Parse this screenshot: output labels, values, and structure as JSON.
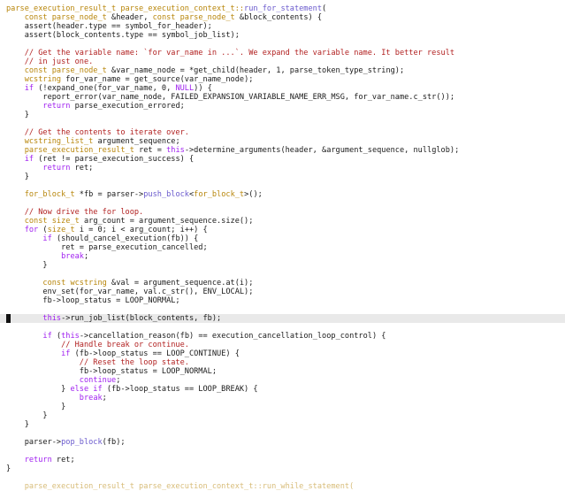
{
  "editor": {
    "cursor_line_index": 35,
    "colors": {
      "keyword": "#a020f0",
      "type": "#b8860b",
      "function": "#6a5acd",
      "string": "#8b4513",
      "comment": "#b22222",
      "number": "#1a1a1a",
      "operator": "#1a1a1a",
      "default": "#1a1a1a",
      "current_line": "#e9e9e9"
    },
    "lines": [
      [
        [
          "parse_execution_result_t parse_execution_context_t::",
          "type"
        ],
        [
          "run_for_statement",
          "function"
        ],
        [
          "(",
          "default"
        ]
      ],
      [
        [
          "    ",
          "default"
        ],
        [
          "const parse_node_t",
          "type"
        ],
        [
          " &header, ",
          "default"
        ],
        [
          "const parse_node_t",
          "type"
        ],
        [
          " &block_contents) {",
          "default"
        ]
      ],
      [
        [
          "    assert(header.type == symbol_for_header);",
          "default"
        ]
      ],
      [
        [
          "    assert(block_contents.type == symbol_job_list);",
          "default"
        ]
      ],
      [
        [
          "",
          "default"
        ]
      ],
      [
        [
          "    // Get the variable name: `for var_name in ...`. We expand the variable name. It better result",
          "comment"
        ]
      ],
      [
        [
          "    // in just one.",
          "comment"
        ]
      ],
      [
        [
          "    ",
          "default"
        ],
        [
          "const parse_node_t",
          "type"
        ],
        [
          " &var_name_node = *get_child(header, 1, parse_token_type_string);",
          "default"
        ]
      ],
      [
        [
          "    ",
          "default"
        ],
        [
          "wcstring",
          "type"
        ],
        [
          " for_var_name = get_source(var_name_node);",
          "default"
        ]
      ],
      [
        [
          "    ",
          "default"
        ],
        [
          "if",
          "keyword"
        ],
        [
          " (!expand_one(for_var_name, 0, ",
          "default"
        ],
        [
          "NULL",
          "keyword"
        ],
        [
          ")) {",
          "default"
        ]
      ],
      [
        [
          "        report_error(var_name_node, FAILED_EXPANSION_VARIABLE_NAME_ERR_MSG, for_var_name.c_str());",
          "default"
        ]
      ],
      [
        [
          "        ",
          "default"
        ],
        [
          "return",
          "keyword"
        ],
        [
          " parse_execution_errored;",
          "default"
        ]
      ],
      [
        [
          "    }",
          "default"
        ]
      ],
      [
        [
          "",
          "default"
        ]
      ],
      [
        [
          "    // Get the contents to iterate over.",
          "comment"
        ]
      ],
      [
        [
          "    ",
          "default"
        ],
        [
          "wcstring_list_t",
          "type"
        ],
        [
          " argument_sequence;",
          "default"
        ]
      ],
      [
        [
          "    ",
          "default"
        ],
        [
          "parse_execution_result_t",
          "type"
        ],
        [
          " ret = ",
          "default"
        ],
        [
          "this",
          "keyword"
        ],
        [
          "->determine_arguments(header, &argument_sequence, nullglob);",
          "default"
        ]
      ],
      [
        [
          "    ",
          "default"
        ],
        [
          "if",
          "keyword"
        ],
        [
          " (ret != parse_execution_success) {",
          "default"
        ]
      ],
      [
        [
          "        ",
          "default"
        ],
        [
          "return",
          "keyword"
        ],
        [
          " ret;",
          "default"
        ]
      ],
      [
        [
          "    }",
          "default"
        ]
      ],
      [
        [
          "",
          "default"
        ]
      ],
      [
        [
          "    ",
          "default"
        ],
        [
          "for_block_t",
          "type"
        ],
        [
          " *fb = parser->",
          "default"
        ],
        [
          "push_block",
          "function"
        ],
        [
          "<",
          "default"
        ],
        [
          "for_block_t",
          "type"
        ],
        [
          ">();",
          "default"
        ]
      ],
      [
        [
          "",
          "default"
        ]
      ],
      [
        [
          "    // Now drive the for loop.",
          "comment"
        ]
      ],
      [
        [
          "    ",
          "default"
        ],
        [
          "const size_t",
          "type"
        ],
        [
          " arg_count = argument_sequence.size();",
          "default"
        ]
      ],
      [
        [
          "    ",
          "default"
        ],
        [
          "for",
          "keyword"
        ],
        [
          " (",
          "default"
        ],
        [
          "size_t",
          "type"
        ],
        [
          " i = 0; i < arg_count; i++) {",
          "default"
        ]
      ],
      [
        [
          "        ",
          "default"
        ],
        [
          "if",
          "keyword"
        ],
        [
          " (should_cancel_execution(fb)) {",
          "default"
        ]
      ],
      [
        [
          "            ret = parse_execution_cancelled;",
          "default"
        ]
      ],
      [
        [
          "            ",
          "default"
        ],
        [
          "break",
          "keyword"
        ],
        [
          ";",
          "default"
        ]
      ],
      [
        [
          "        }",
          "default"
        ]
      ],
      [
        [
          "",
          "default"
        ]
      ],
      [
        [
          "        ",
          "default"
        ],
        [
          "const wcstring",
          "type"
        ],
        [
          " &val = argument_sequence.at(i);",
          "default"
        ]
      ],
      [
        [
          "        env_set(for_var_name, val.c_str(), ENV_LOCAL);",
          "default"
        ]
      ],
      [
        [
          "        fb->loop_status = LOOP_NORMAL;",
          "default"
        ]
      ],
      [
        [
          "",
          "default"
        ]
      ],
      [
        [
          "        ",
          "default"
        ],
        [
          "this",
          "keyword"
        ],
        [
          "->run_job_list(block_contents, fb);",
          "default"
        ]
      ],
      [
        [
          "",
          "default"
        ]
      ],
      [
        [
          "        ",
          "default"
        ],
        [
          "if",
          "keyword"
        ],
        [
          " (",
          "default"
        ],
        [
          "this",
          "keyword"
        ],
        [
          "->cancellation_reason(fb) == execution_cancellation_loop_control) {",
          "default"
        ]
      ],
      [
        [
          "            // Handle break or continue.",
          "comment"
        ]
      ],
      [
        [
          "            ",
          "default"
        ],
        [
          "if",
          "keyword"
        ],
        [
          " (fb->loop_status == LOOP_CONTINUE) {",
          "default"
        ]
      ],
      [
        [
          "                // Reset the loop state.",
          "comment"
        ]
      ],
      [
        [
          "                fb->loop_status = LOOP_NORMAL;",
          "default"
        ]
      ],
      [
        [
          "                ",
          "default"
        ],
        [
          "continue",
          "keyword"
        ],
        [
          ";",
          "default"
        ]
      ],
      [
        [
          "            } ",
          "default"
        ],
        [
          "else if",
          "keyword"
        ],
        [
          " (fb->loop_status == LOOP_BREAK) {",
          "default"
        ]
      ],
      [
        [
          "                ",
          "default"
        ],
        [
          "break",
          "keyword"
        ],
        [
          ";",
          "default"
        ]
      ],
      [
        [
          "            }",
          "default"
        ]
      ],
      [
        [
          "        }",
          "default"
        ]
      ],
      [
        [
          "    }",
          "default"
        ]
      ],
      [
        [
          "",
          "default"
        ]
      ],
      [
        [
          "    parser->",
          "default"
        ],
        [
          "pop_block",
          "function"
        ],
        [
          "(fb);",
          "default"
        ]
      ],
      [
        [
          "",
          "default"
        ]
      ],
      [
        [
          "    ",
          "default"
        ],
        [
          "return",
          "keyword"
        ],
        [
          " ret;",
          "default"
        ]
      ],
      [
        [
          "}",
          "default"
        ]
      ]
    ],
    "cut_line": [
      [
        "    parse_execution_result_t parse_execution_context_t::run_while_statement(",
        "type"
      ]
    ]
  }
}
